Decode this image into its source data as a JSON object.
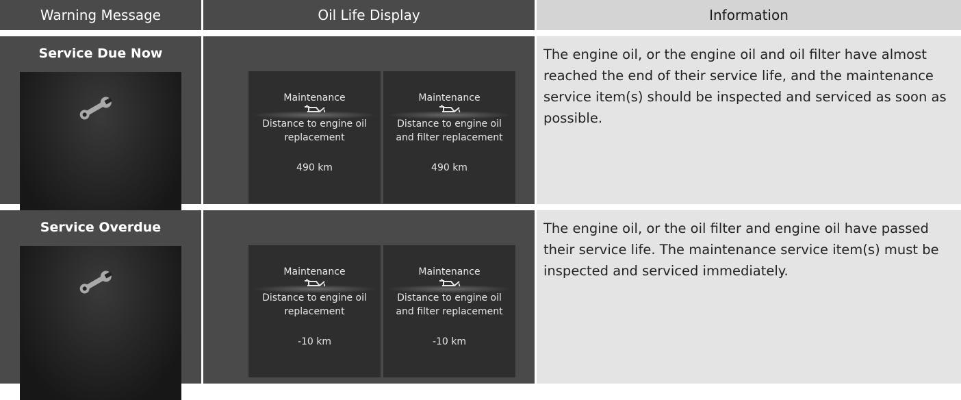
{
  "header": {
    "warning_message": "Warning Message",
    "oil_life_display": "Oil Life Display",
    "information": "Information"
  },
  "rows": [
    {
      "warning_title": "Service Due Now",
      "warning_icon": "wrench-icon",
      "displays": [
        {
          "title": "Maintenance",
          "icon": "oil-can-icon",
          "line1": "Distance to engine oil",
          "line2": "replacement",
          "value": "490 km"
        },
        {
          "title": "Maintenance",
          "icon": "oil-can-icon",
          "line1": "Distance to engine oil",
          "line2": "and filter replacement",
          "value": "490 km"
        }
      ],
      "info": "The engine oil, or the engine oil and oil filter have almost reached the end of their service life, and the maintenance service item(s) should be inspected and serviced as soon as possible."
    },
    {
      "warning_title": "Service Overdue",
      "warning_icon": "wrench-icon",
      "displays": [
        {
          "title": "Maintenance",
          "icon": "oil-can-icon",
          "line1": "Distance to engine oil",
          "line2": "replacement",
          "value": "-10 km"
        },
        {
          "title": "Maintenance",
          "icon": "oil-can-icon",
          "line1": "Distance to engine oil",
          "line2": "and filter replacement",
          "value": "-10 km"
        }
      ],
      "info": "The engine oil, or the oil filter and engine oil have passed their service life. The maintenance service item(s) must be inspected and serviced immediately."
    }
  ]
}
